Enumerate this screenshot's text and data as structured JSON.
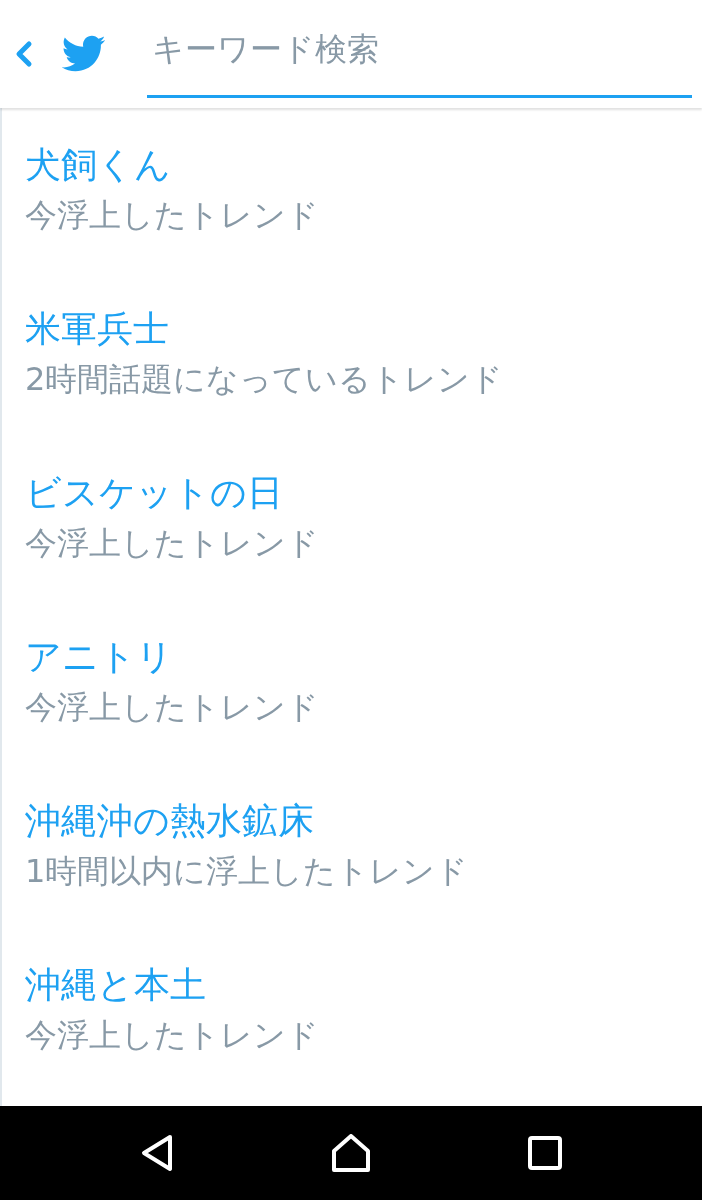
{
  "header": {
    "search": {
      "placeholder": "キーワード検索",
      "focused": true
    }
  },
  "trends": [
    {
      "name": "犬飼くん",
      "description": "今浮上したトレンド"
    },
    {
      "name": "米軍兵士",
      "description": "2時間話題になっているトレンド"
    },
    {
      "name": "ビスケットの日",
      "description": "今浮上したトレンド"
    },
    {
      "name": "アニトリ",
      "description": "今浮上したトレンド"
    },
    {
      "name": "沖縄沖の熱水鉱床",
      "description": "1時間以内に浮上したトレンド"
    },
    {
      "name": "沖縄と本土",
      "description": "今浮上したトレンド"
    }
  ]
}
